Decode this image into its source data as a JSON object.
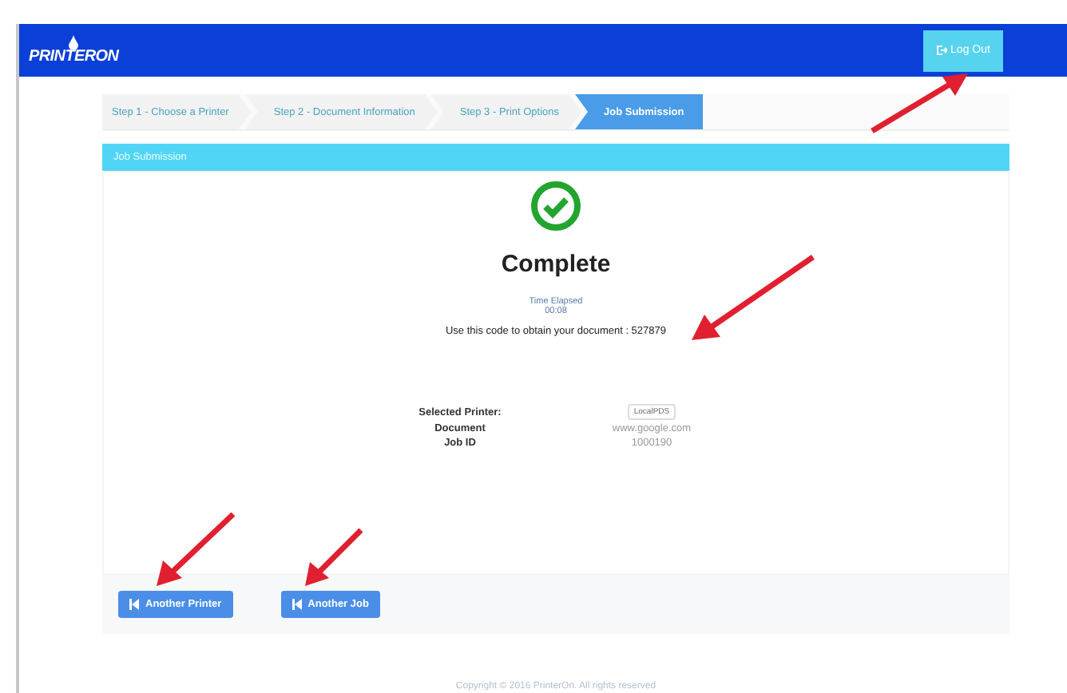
{
  "header": {
    "logo": "PRINTERON",
    "logout_button": "Log Out"
  },
  "steps": [
    {
      "label": "Step 1 - Choose a Printer",
      "selected": false
    },
    {
      "label": "Step 2 - Document Information",
      "selected": false
    },
    {
      "label": "Step 3 - Print Options",
      "selected": false
    },
    {
      "label": "Job Submission",
      "selected": true
    }
  ],
  "panel": {
    "title": "Job Submission",
    "status": "Complete",
    "elapsed_label": "Time Elapsed",
    "elapsed": "00:08",
    "code_message": "Use this code to obtain your document : 527879",
    "details": [
      {
        "label": "Selected Printer:",
        "value": "LocalPDS",
        "kind": "badge"
      },
      {
        "label": "Document",
        "value": "www.google.com",
        "kind": "text"
      },
      {
        "label": "Job ID",
        "value": "1000190",
        "kind": "text"
      }
    ],
    "buttons": [
      "Another Printer",
      "Another Job"
    ]
  },
  "footer": "Copyright © 2016 PrinterOn. All rights reserved"
}
